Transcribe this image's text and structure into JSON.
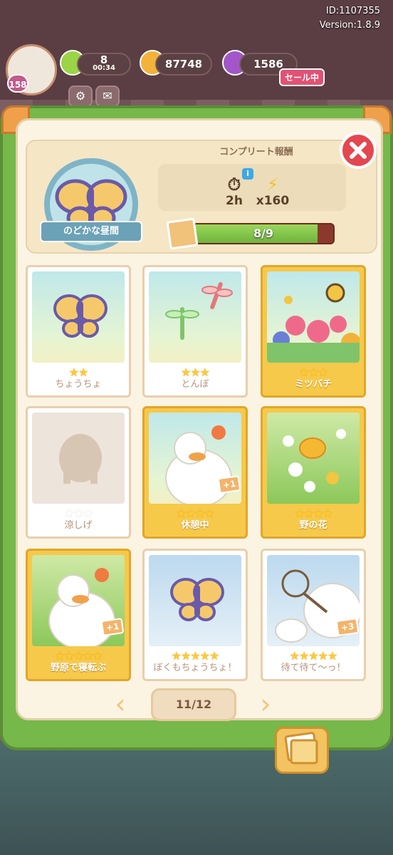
{
  "topbar": {
    "player_level": "158",
    "energy": "8",
    "energy_timer": "00:34",
    "coins": "87748",
    "gems": "1586",
    "sale_badge": "セール中",
    "id_text": "ID:1107355",
    "version_text": "Version:1.8.9"
  },
  "header": {
    "reward_title": "コンプリート報酬",
    "medal_label": "のどかな昼間",
    "rewards": [
      {
        "icon": "stopwatch-icon",
        "amount": "2h"
      },
      {
        "icon": "lightning-icon",
        "amount": "x160"
      }
    ],
    "progress_text": "8/9",
    "progress_fraction": 0.889
  },
  "cards": [
    {
      "label": "ちょうちょ",
      "stars": 2,
      "max": 2,
      "style": "normal",
      "art": "sky",
      "art_icon": "butterfly-icon",
      "bonus": ""
    },
    {
      "label": "とんぼ",
      "stars": 3,
      "max": 3,
      "style": "normal",
      "art": "sky",
      "art_icon": "dragonfly-icon",
      "bonus": ""
    },
    {
      "label": "ミツバチ",
      "stars": 3,
      "max": 3,
      "style": "gold",
      "art": "sky",
      "art_icon": "bee-icon",
      "bonus": ""
    },
    {
      "label": "涼しげ",
      "stars": 0,
      "max": 3,
      "style": "normal",
      "art": "blank",
      "art_icon": "silhouette-icon",
      "bonus": ""
    },
    {
      "label": "休憩中",
      "stars": 4,
      "max": 4,
      "style": "gold",
      "art": "sky",
      "art_icon": "duck-icon",
      "bonus": "+1"
    },
    {
      "label": "野の花",
      "stars": 4,
      "max": 4,
      "style": "gold",
      "art": "field",
      "art_icon": "flower-icon",
      "bonus": ""
    },
    {
      "label": "野原で寝転ぶ",
      "stars": 5,
      "max": 5,
      "style": "gold",
      "art": "field",
      "art_icon": "duck-icon",
      "bonus": "+1"
    },
    {
      "label": "ぼくもちょうちょ！",
      "stars": 5,
      "max": 5,
      "style": "normal",
      "art": "blue",
      "art_icon": "butterfly-icon",
      "bonus": ""
    },
    {
      "label": "待て待て〜っ！",
      "stars": 5,
      "max": 5,
      "style": "normal",
      "art": "blue",
      "art_icon": "net-icon",
      "bonus": "+3"
    }
  ],
  "pager": {
    "page_text": "11/12"
  },
  "colors": {
    "book_green": "#76b84a",
    "page_cream": "#fbf4e3",
    "gold_card": "#f6c94a",
    "close_red": "#e4474f"
  }
}
